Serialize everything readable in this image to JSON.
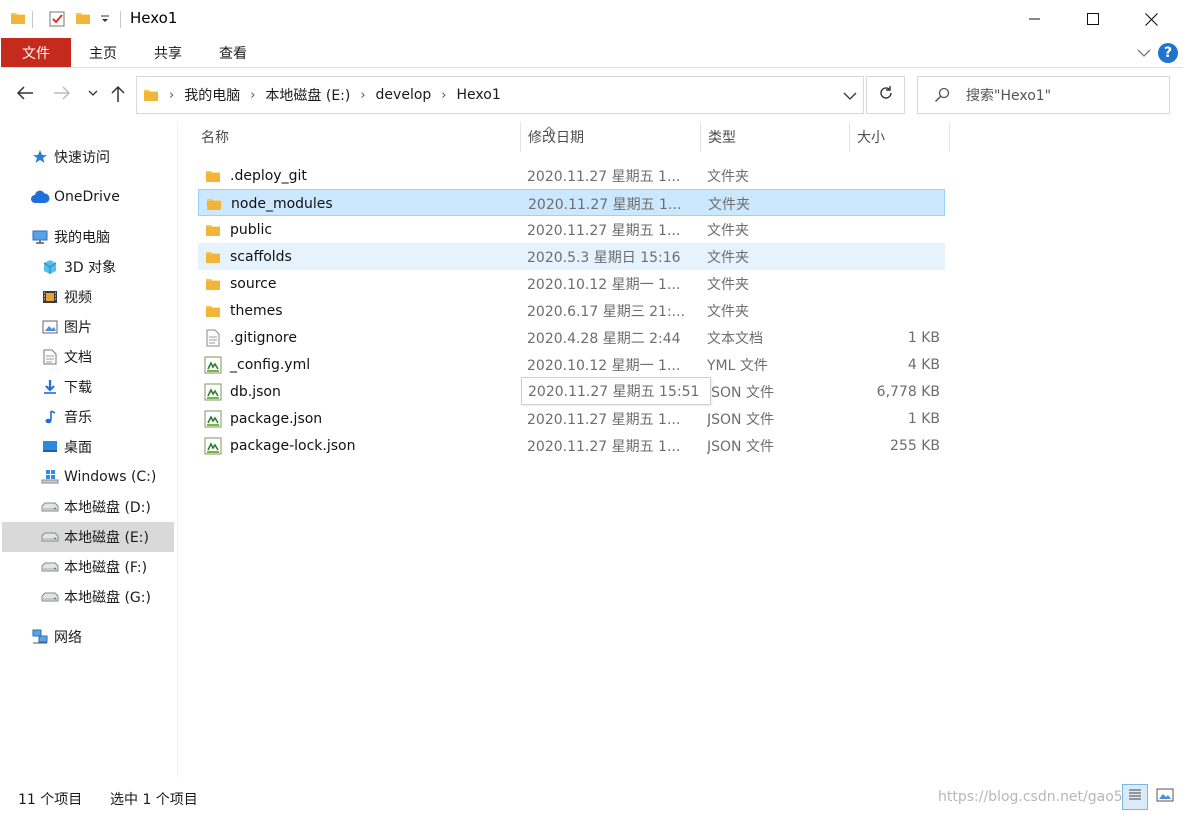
{
  "window": {
    "title": "Hexo1"
  },
  "ribbon": {
    "tabs": [
      {
        "label": "文件"
      },
      {
        "label": "主页"
      },
      {
        "label": "共享"
      },
      {
        "label": "查看"
      }
    ],
    "help_label": "?"
  },
  "address": {
    "crumbs": [
      "我的电脑",
      "本地磁盘 (E:)",
      "develop",
      "Hexo1"
    ],
    "separator": "›"
  },
  "search": {
    "placeholder": "搜索\"Hexo1\""
  },
  "sidebar": {
    "items": [
      {
        "label": "快速访问",
        "icon": "star-icon"
      },
      {
        "label": "OneDrive",
        "icon": "cloud-icon"
      },
      {
        "label": "我的电脑",
        "icon": "computer-icon"
      },
      {
        "label": "3D 对象",
        "icon": "cube-icon"
      },
      {
        "label": "视频",
        "icon": "film-icon"
      },
      {
        "label": "图片",
        "icon": "picture-icon"
      },
      {
        "label": "文档",
        "icon": "document-icon"
      },
      {
        "label": "下载",
        "icon": "download-icon"
      },
      {
        "label": "音乐",
        "icon": "music-icon"
      },
      {
        "label": "桌面",
        "icon": "desktop-icon"
      },
      {
        "label": "Windows (C:)",
        "icon": "windows-drive-icon"
      },
      {
        "label": "本地磁盘 (D:)",
        "icon": "drive-icon"
      },
      {
        "label": "本地磁盘 (E:)",
        "icon": "drive-icon"
      },
      {
        "label": "本地磁盘 (F:)",
        "icon": "drive-icon"
      },
      {
        "label": "本地磁盘 (G:)",
        "icon": "drive-icon"
      },
      {
        "label": "网络",
        "icon": "network-icon"
      }
    ],
    "active_index": 12
  },
  "columns": {
    "name": "名称",
    "date": "修改日期",
    "type": "类型",
    "size": "大小"
  },
  "files": [
    {
      "name": ".deploy_git",
      "date": "2020.11.27  星期五 1...",
      "type": "文件夹",
      "size": "",
      "icon": "folder-icon"
    },
    {
      "name": "node_modules",
      "date": "2020.11.27  星期五 1...",
      "type": "文件夹",
      "size": "",
      "icon": "folder-icon"
    },
    {
      "name": "public",
      "date": "2020.11.27  星期五 1...",
      "type": "文件夹",
      "size": "",
      "icon": "folder-icon"
    },
    {
      "name": "scaffolds",
      "date": "2020.5.3  星期日 15:16",
      "type": "文件夹",
      "size": "",
      "icon": "folder-icon"
    },
    {
      "name": "source",
      "date": "2020.10.12  星期一 1...",
      "type": "文件夹",
      "size": "",
      "icon": "folder-icon"
    },
    {
      "name": "themes",
      "date": "2020.6.17  星期三 21:...",
      "type": "文件夹",
      "size": "",
      "icon": "folder-icon"
    },
    {
      "name": ".gitignore",
      "date": "2020.4.28  星期二 2:44",
      "type": "文本文档",
      "size": "1 KB",
      "icon": "text-file-icon"
    },
    {
      "name": "_config.yml",
      "date": "2020.10.12  星期一 1...",
      "type": "YML 文件",
      "size": "4 KB",
      "icon": "script-file-icon"
    },
    {
      "name": "db.json",
      "date": "2020.11.27  星期五 1...",
      "type": "JSON 文件",
      "size": "6,778 KB",
      "icon": "script-file-icon"
    },
    {
      "name": "package.json",
      "date": "2020.11.27  星期五 1...",
      "type": "JSON 文件",
      "size": "1 KB",
      "icon": "script-file-icon"
    },
    {
      "name": "package-lock.json",
      "date": "2020.11.27  星期五 1...",
      "type": "JSON 文件",
      "size": "255 KB",
      "icon": "script-file-icon"
    }
  ],
  "selected_index": 1,
  "hover_index": 3,
  "tooltip": {
    "text": "2020.11.27  星期五 15:51"
  },
  "status": {
    "count": "11 个项目",
    "selection": "选中 1 个项目",
    "watermark": "https://blog.csdn.net/gao5..."
  },
  "colors": {
    "file_tab": "#c42b1c",
    "selected_row": "#cce8ff",
    "hover_row": "#e5f3ff",
    "folder": "#f7c948",
    "help": "#1e74cf"
  }
}
